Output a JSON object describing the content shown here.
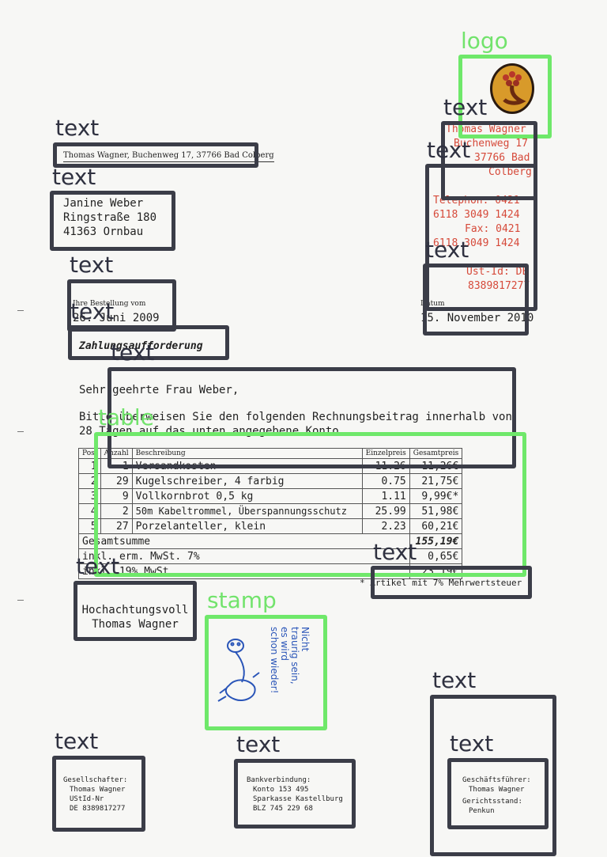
{
  "annotations": {
    "logo": "logo",
    "text": "text",
    "table": "table",
    "stamp": "stamp"
  },
  "sender_line": "Thomas Wagner, Buchenweg 17, 37766 Bad Colberg",
  "recipient": [
    "Janine Weber",
    "Ringstraße 180",
    "41363 Ornbau"
  ],
  "letterhead": {
    "name": "Thomas Wagner",
    "street": "Buchenweg 17",
    "city": "37766 Bad",
    "city2": "Colberg",
    "phone_label": "Telephon:",
    "phone": "0421",
    "phone2": "6118 3049 1424",
    "fax_label": "Fax:",
    "fax": "0421",
    "fax2": "6118 3049 1424",
    "ustid_label": "Ust-Id:",
    "ustid": "DE",
    "ustid2": "8389817277"
  },
  "order_label": "Ihre Bestellung vom",
  "order_date": "26. Juni 2009",
  "date_label": "Datum",
  "date": "15. November 2010",
  "subject": "Zahlungsaufforderung",
  "salutation": "Sehr geehrte Frau Weber,",
  "body_line1": "Bitte überweisen Sie den folgenden Rechnungsbeitrag innerhalb von",
  "body_line2": "28 Tagen auf das unten angegebene Konto.",
  "table": {
    "headers": [
      "Pos.",
      "Anzahl",
      "Beschreibung",
      "Einzelpreis",
      "Gesamtpreis"
    ],
    "rows": [
      [
        "1",
        "1",
        "Versandkosten",
        "11.26",
        "11,26€"
      ],
      [
        "2",
        "29",
        "Kugelschreiber, 4 farbig",
        "0.75",
        "21,75€"
      ],
      [
        "3",
        "9",
        "Vollkornbrot 0,5 kg",
        "1.11",
        "9,99€*"
      ],
      [
        "4",
        "2",
        "50m Kabeltrommel, Überspannungsschutz",
        "25.99",
        "51,98€"
      ],
      [
        "5",
        "27",
        "Porzelanteller, klein",
        "2.23",
        "60,21€"
      ]
    ],
    "total_label": "Gesamtsumme",
    "total": "155,19€",
    "tax1_label": "inkl. erm. MwSt. 7%",
    "tax1": "0,65€",
    "tax2_label": "inkl. 19% MwSt",
    "tax2": "23,19€",
    "footnote": "* Artikel mit 7% Mehrwertsteuer"
  },
  "closing": [
    "Hochachtungsvoll",
    "Thomas Wagner"
  ],
  "stamp_text": [
    "Nicht",
    "traurig sein,",
    "es wird",
    "schon wieder!"
  ],
  "footer": {
    "col1": [
      "Gesellschafter:",
      "Thomas Wagner",
      "UStId-Nr",
      "DE 8389817277"
    ],
    "col2": [
      "Bankverbindung:",
      "Konto 153 495",
      "Sparkasse Kastellburg",
      "BLZ 745 229 68"
    ],
    "col3": [
      "Geschäftsführer:",
      "Thomas Wagner",
      "Gerichtsstand:",
      "Penkun"
    ]
  },
  "colors": {
    "letterhead": "#d64a3a",
    "box": "#3b3d48",
    "green": "#6fe86a",
    "stamp": "#2a55b8"
  }
}
